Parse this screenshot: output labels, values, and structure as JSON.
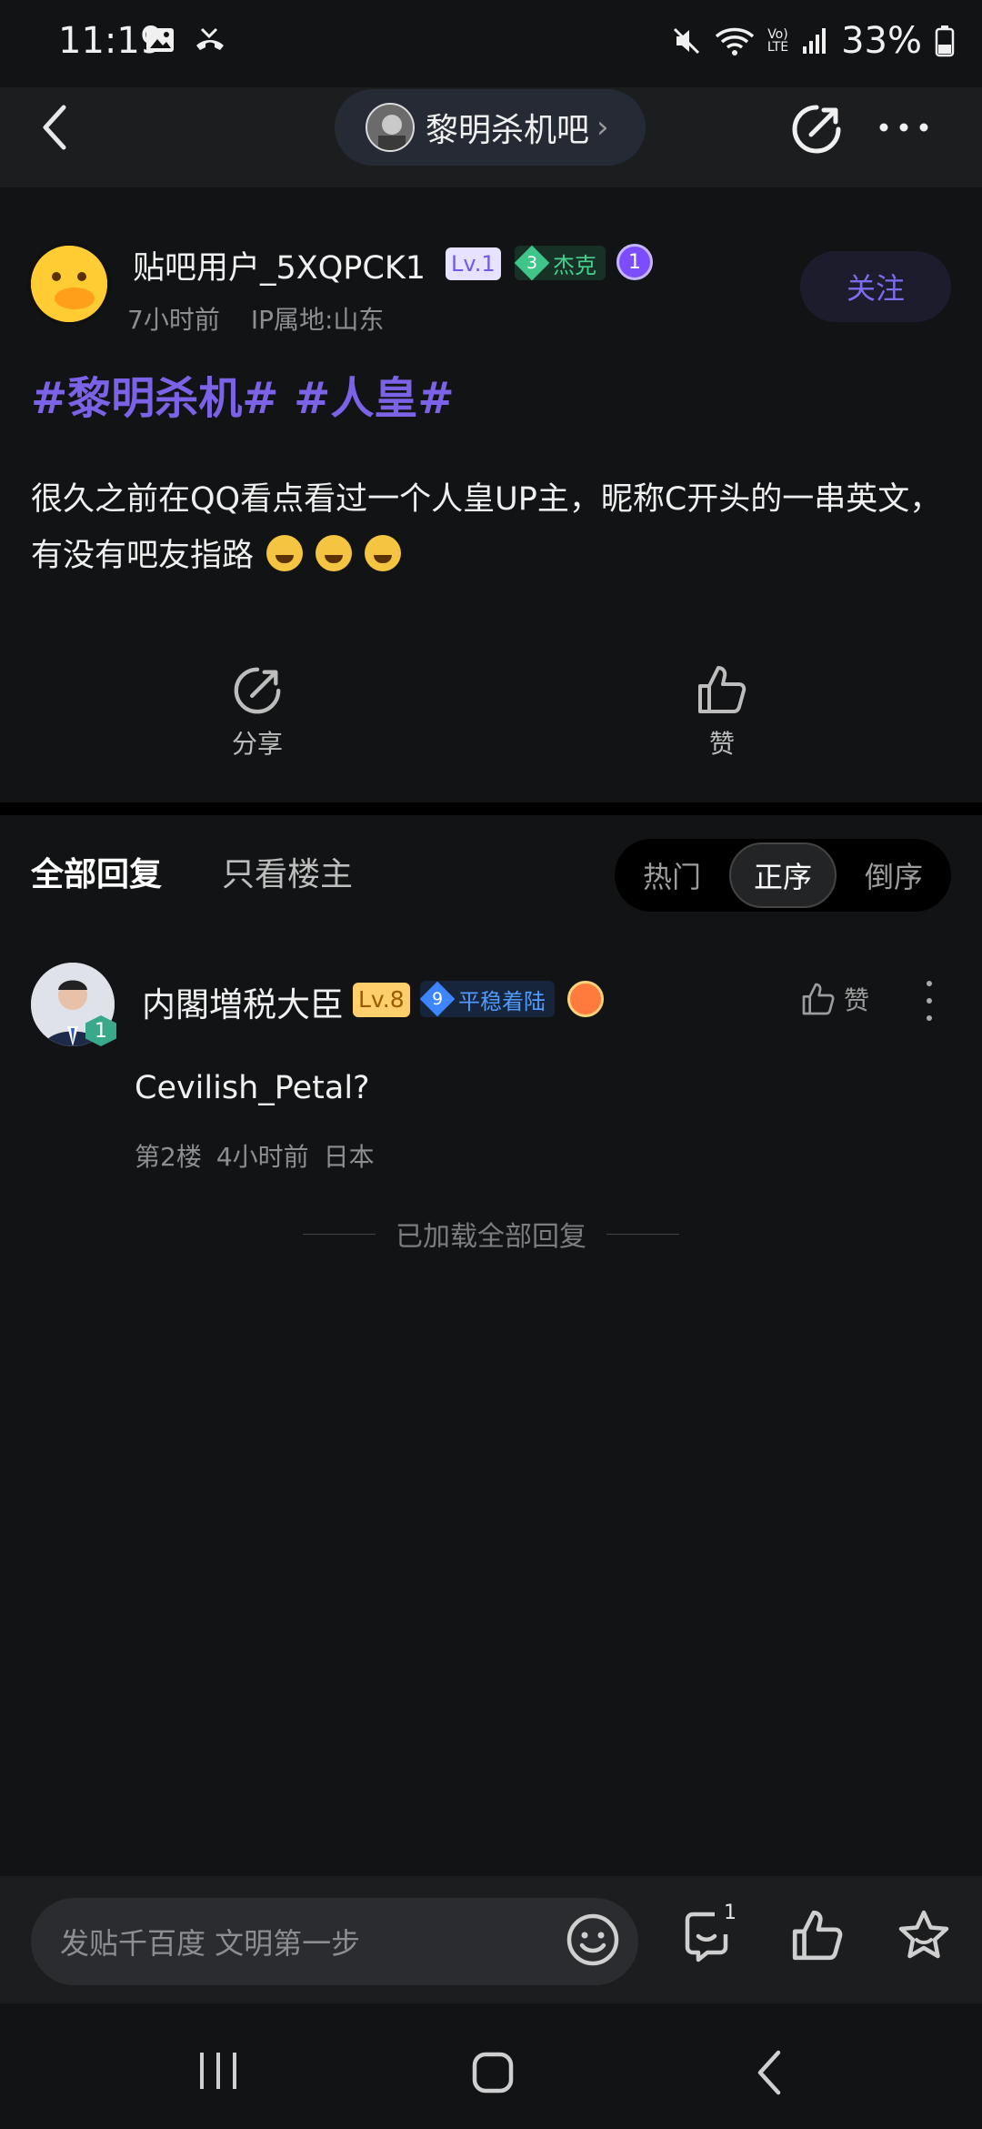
{
  "status_bar": {
    "time": "11:19",
    "battery": "33%",
    "icons": [
      "image-icon",
      "missed-call-icon",
      "mute-icon",
      "wifi-icon",
      "volte-icon",
      "signal-icon",
      "battery-icon"
    ]
  },
  "top_bar": {
    "forum_name": "黎明杀机吧",
    "chevron": "›",
    "icons": [
      "back-icon",
      "share-icon",
      "more-icon"
    ]
  },
  "post": {
    "username": "贴吧用户_5XQPCK1",
    "level": "Lv.1",
    "rank_num": "3",
    "rank_title": "杰克",
    "medal": "1",
    "time": "7小时前",
    "ip": "IP属地:山东",
    "follow_label": "关注",
    "hashtags": "#黎明杀机# #人皇#",
    "body": "很久之前在QQ看点看过一个人皇UP主，昵称C开头的一串英文，有没有吧友指路",
    "actions": {
      "share": "分享",
      "like": "赞"
    }
  },
  "replies_header": {
    "tab_all": "全部回复",
    "tab_owner": "只看楼主",
    "sort": [
      "热门",
      "正序",
      "倒序"
    ],
    "active_sort": "正序"
  },
  "reply": {
    "username": "内閣増税大臣",
    "level": "Lv.8",
    "rank_num": "9",
    "rank_title": "平稳着陆",
    "avatar_badge": "1",
    "like_label": "赞",
    "text": "Cevilish_Petal?",
    "floor": "第2楼",
    "time": "4小时前",
    "location": "日本"
  },
  "loaded_text": "已加载全部回复",
  "bottom_bar": {
    "input_placeholder": "发贴千百度 文明第一步",
    "comment_count": "1"
  },
  "colors": {
    "background": "#111314",
    "accent_purple": "#7c62e6",
    "follow_text": "#7c6cf0"
  }
}
